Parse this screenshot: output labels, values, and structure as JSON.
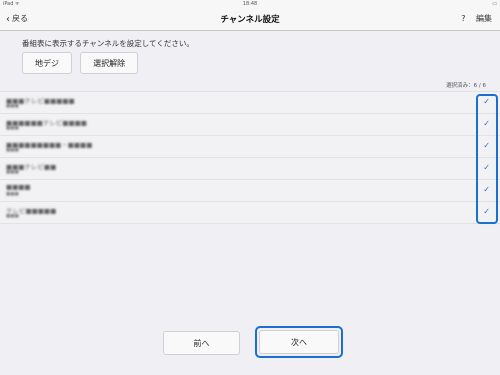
{
  "status_bar": {
    "left": "iPad ᯤ",
    "center": "18:48",
    "right": "▭"
  },
  "nav": {
    "back_label": "戻る",
    "title": "チャンネル設定",
    "help_label": "?",
    "edit_label": "編集"
  },
  "instruction": "番組表に表示するチャンネルを設定してください。",
  "buttons": {
    "terrestrial": "地デジ",
    "deselect": "選択解除"
  },
  "selected_count": "選択済み：6 / 6",
  "channels": [
    {
      "name": "■■■テレビ■■■■■",
      "sub": "■■■",
      "checked": true
    },
    {
      "name": "■■■■■■テレビ■■■■",
      "sub": "■■■",
      "checked": true
    },
    {
      "name": "■■■■■■■■■・■■■■",
      "sub": "■■■",
      "checked": true
    },
    {
      "name": "■■■テレビ■■",
      "sub": "■■■",
      "checked": true
    },
    {
      "name": "■■■■",
      "sub": "■■■",
      "checked": true
    },
    {
      "name": "テレビ■■■■■",
      "sub": "■■■",
      "checked": true
    }
  ],
  "check_glyph": "✓",
  "footer": {
    "prev_label": "前へ",
    "next_label": "次へ"
  },
  "colors": {
    "accent": "#1a6fd1",
    "background": "#efeff4"
  }
}
